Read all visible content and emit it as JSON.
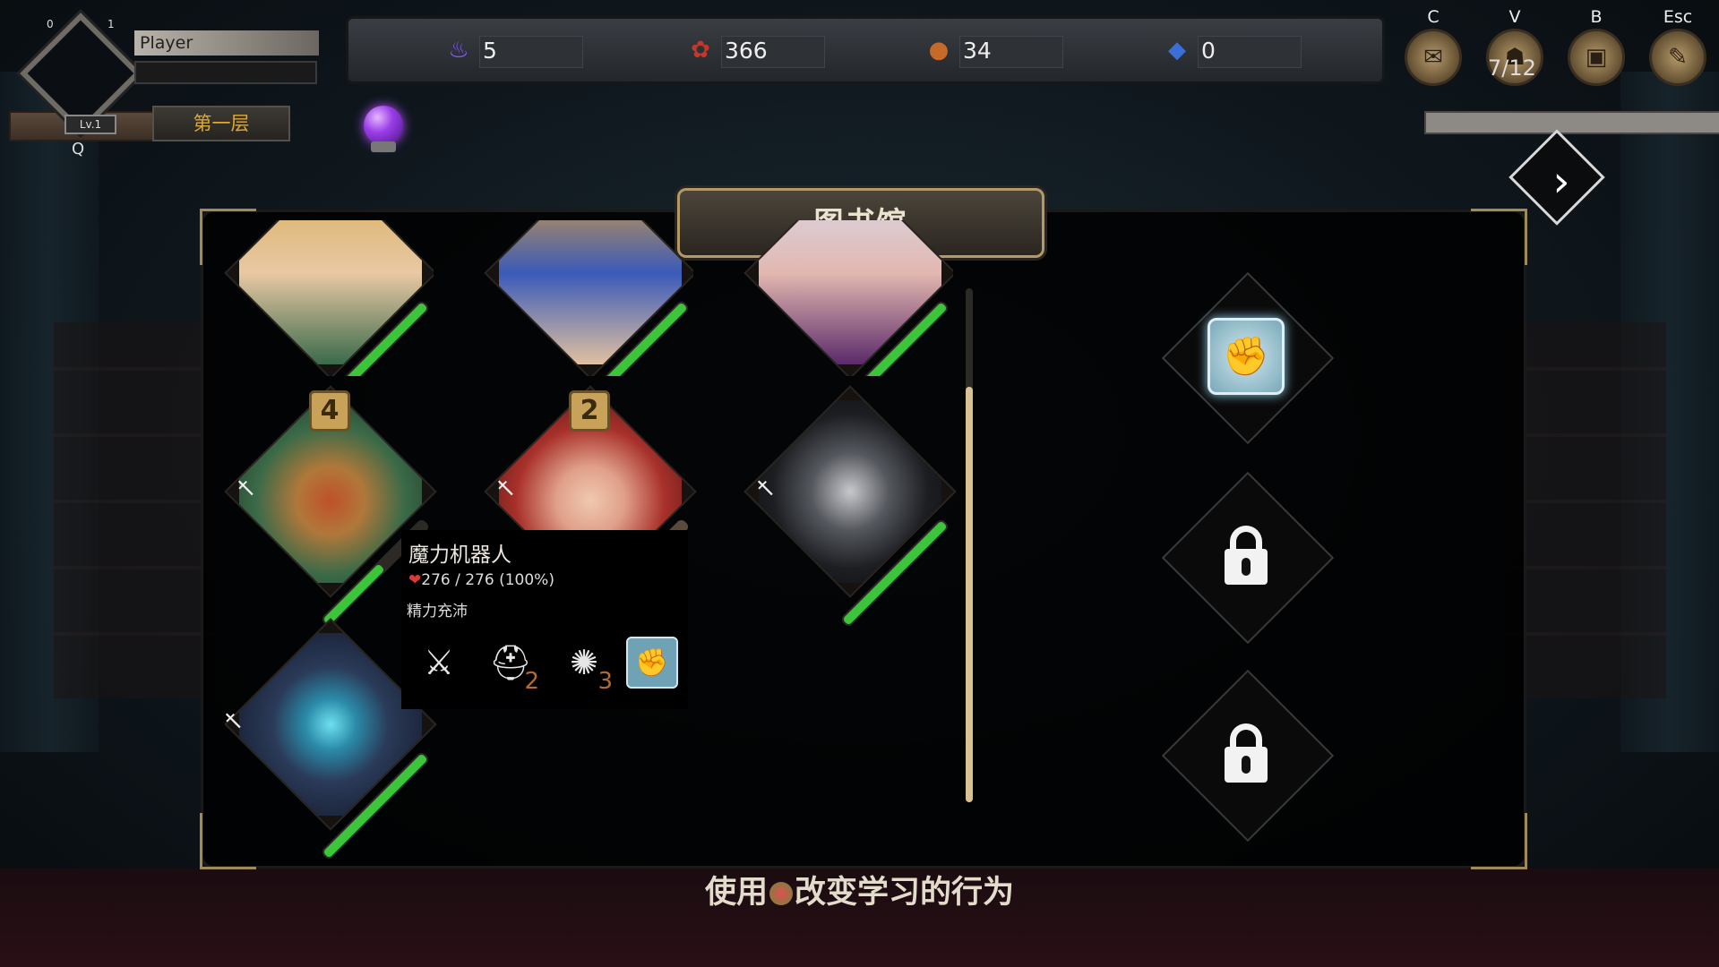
{
  "player": {
    "name": "Player",
    "level": "Lv.1",
    "left_count": "0",
    "right_count": "1",
    "floor": "第一层",
    "hotkey": "Q"
  },
  "resources": [
    {
      "icon": "soul-flame-icon",
      "value": "5",
      "color": "#8b5cf6"
    },
    {
      "icon": "gem-cluster-icon",
      "value": "366",
      "color": "#c0392b"
    },
    {
      "icon": "meat-icon",
      "value": "34",
      "color": "#c66a2a"
    },
    {
      "icon": "blue-crystal-icon",
      "value": "0",
      "color": "#3b6fd8"
    }
  ],
  "menus": [
    {
      "key": "C",
      "icon": "map-scroll-icon"
    },
    {
      "key": "V",
      "icon": "party-icon"
    },
    {
      "key": "B",
      "icon": "backpack-icon"
    },
    {
      "key": "Esc",
      "icon": "settings-scroll-icon"
    }
  ],
  "party_count": "7/12",
  "panel": {
    "title": "图书馆"
  },
  "cards": [
    {
      "name": "card-blonde-heroine",
      "badge": null,
      "hp": 1.0
    },
    {
      "name": "card-blue-mage",
      "badge": null,
      "hp": 1.0
    },
    {
      "name": "card-white-haired-priestess",
      "badge": null,
      "hp": 1.0
    },
    {
      "name": "card-dwarf-engineer",
      "badge": "4",
      "hp": 0.55
    },
    {
      "name": "card-red-haired-girl",
      "badge": "2",
      "hp": 0.0
    },
    {
      "name": "card-hooded-rogue",
      "badge": null,
      "hp": 1.0
    },
    {
      "name": "card-magic-robot",
      "badge": null,
      "hp": 1.0
    }
  ],
  "tooltip": {
    "name": "魔力机器人",
    "hp": "276 / 276 (100%)",
    "status": "精力充沛",
    "skills": [
      {
        "icon": "crossed-attack-icon",
        "count": ""
      },
      {
        "icon": "helmet-icon",
        "count": "2"
      },
      {
        "icon": "scarab-icon",
        "count": "3"
      },
      {
        "icon": "armor-shield-icon",
        "count": ""
      }
    ]
  },
  "slots": [
    {
      "icon": "armor-shield-icon",
      "locked": false
    },
    {
      "icon": "lock-icon",
      "locked": true
    },
    {
      "icon": "lock-icon",
      "locked": true
    }
  ],
  "hint": {
    "before": "使用",
    "after": "改变学习的行为"
  },
  "colors": {
    "hp_green": "#3cc43a",
    "gold_trim": "#b29a68",
    "floor_text": "#e0a830"
  }
}
